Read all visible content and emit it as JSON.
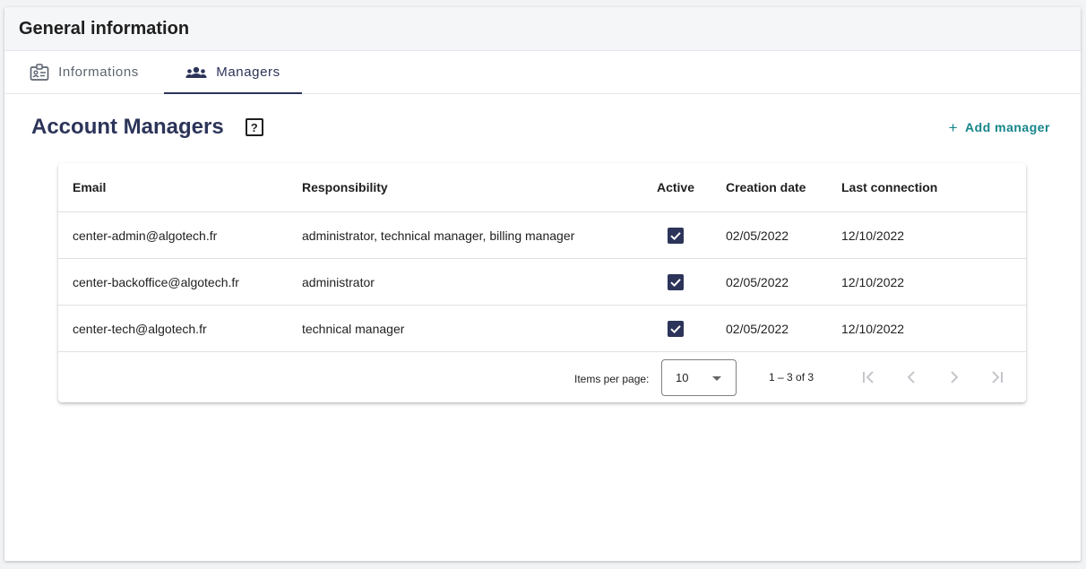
{
  "header": {
    "title": "General information"
  },
  "tabs": [
    {
      "label": "Informations",
      "icon": "id-card-icon",
      "active": false
    },
    {
      "label": "Managers",
      "icon": "group-icon",
      "active": true
    }
  ],
  "section": {
    "title": "Account Managers",
    "help_icon": "question-mark-icon",
    "help_glyph": "?",
    "add_glyph": "+",
    "add_label": "Add manager"
  },
  "table": {
    "columns": [
      "Email",
      "Responsibility",
      "Active",
      "Creation date",
      "Last connection"
    ],
    "rows": [
      {
        "email": "center-admin@algotech.fr",
        "responsibility": "administrator, technical manager, billing manager",
        "active": true,
        "created": "02/05/2022",
        "last": "12/10/2022"
      },
      {
        "email": "center-backoffice@algotech.fr",
        "responsibility": "administrator",
        "active": true,
        "created": "02/05/2022",
        "last": "12/10/2022"
      },
      {
        "email": "center-tech@algotech.fr",
        "responsibility": "technical manager",
        "active": true,
        "created": "02/05/2022",
        "last": "12/10/2022"
      }
    ]
  },
  "paginator": {
    "items_per_page_label": "Items per page:",
    "items_per_page_value": "10",
    "range_label": "1 – 3 of 3"
  },
  "colors": {
    "accent": "#2c3459",
    "link": "#14858a",
    "disabled_icon": "#c4c6cb"
  }
}
